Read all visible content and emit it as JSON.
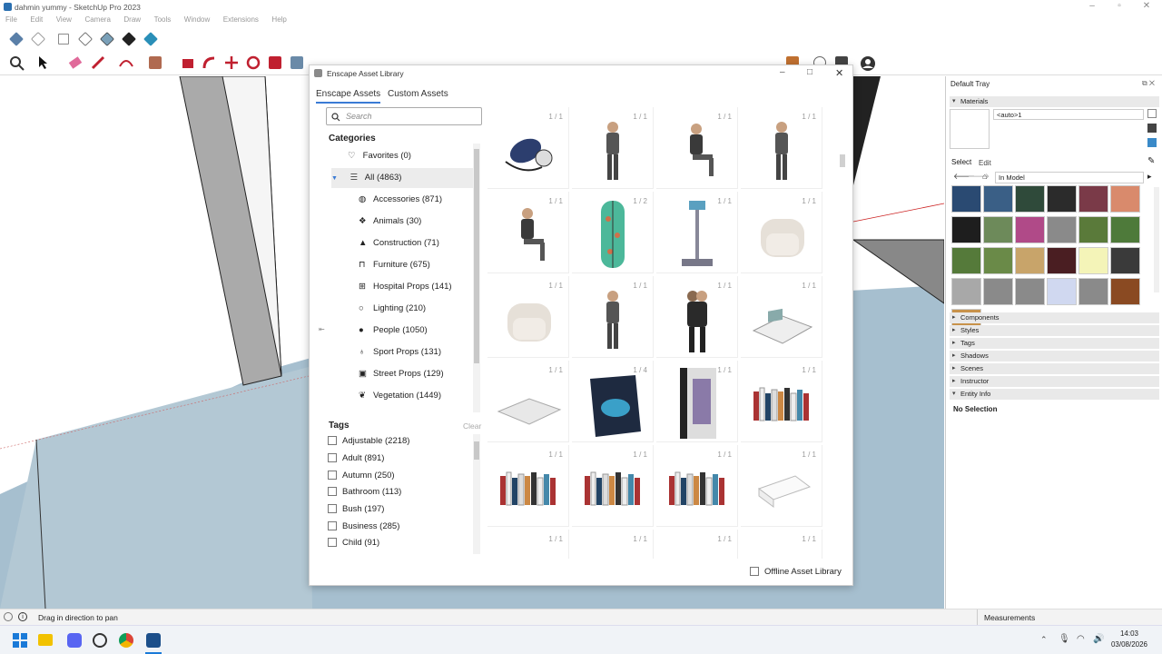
{
  "app": {
    "title": "dahmin yummy - SketchUp Pro 2023"
  },
  "menubar": [
    "File",
    "Edit",
    "View",
    "Camera",
    "Draw",
    "Tools",
    "Window",
    "Extensions",
    "Help"
  ],
  "dialog": {
    "title": "Enscape Asset Library",
    "tabs": [
      "Enscape Assets",
      "Custom Assets"
    ],
    "search_placeholder": "Search",
    "categories_heading": "Categories",
    "categories": [
      {
        "label": "Favorites (0)",
        "icon": "heart-icon"
      },
      {
        "label": "All (4863)",
        "icon": "list-icon"
      },
      {
        "label": "Accessories (871)",
        "icon": "accessories-icon"
      },
      {
        "label": "Animals (30)",
        "icon": "paw-icon"
      },
      {
        "label": "Construction (71)",
        "icon": "hardhat-icon"
      },
      {
        "label": "Furniture (675)",
        "icon": "armchair-icon"
      },
      {
        "label": "Hospital Props (141)",
        "icon": "hospital-icon"
      },
      {
        "label": "Lighting (210)",
        "icon": "bulb-icon"
      },
      {
        "label": "People (1050)",
        "icon": "people-icon"
      },
      {
        "label": "Sport Props (131)",
        "icon": "whistle-icon"
      },
      {
        "label": "Street Props (129)",
        "icon": "street-icon"
      },
      {
        "label": "Vegetation (1449)",
        "icon": "leaf-icon"
      }
    ],
    "tags_heading": "Tags",
    "tags_clear": "Clear",
    "tags": [
      "Adjustable (2218)",
      "Adult (891)",
      "Autumn (250)",
      "Bathroom (113)",
      "Bush (197)",
      "Business (285)",
      "Child (91)"
    ],
    "assets": [
      {
        "count": "1 / 1",
        "kind": "blood-pressure-cuff"
      },
      {
        "count": "1 / 1",
        "kind": "person-standing"
      },
      {
        "count": "1 / 1",
        "kind": "person-sitting"
      },
      {
        "count": "1 / 1",
        "kind": "person-standing"
      },
      {
        "count": "1 / 1",
        "kind": "person-sitting"
      },
      {
        "count": "1 / 2",
        "kind": "bodyboard"
      },
      {
        "count": "1 / 1",
        "kind": "scale"
      },
      {
        "count": "1 / 1",
        "kind": "armchair"
      },
      {
        "count": "1 / 1",
        "kind": "armchair"
      },
      {
        "count": "1 / 1",
        "kind": "person-standing"
      },
      {
        "count": "1 / 1",
        "kind": "couple-hug"
      },
      {
        "count": "1 / 1",
        "kind": "magazine"
      },
      {
        "count": "1 / 1",
        "kind": "open-book"
      },
      {
        "count": "1 / 4",
        "kind": "book-cover"
      },
      {
        "count": "1 / 1",
        "kind": "color-book"
      },
      {
        "count": "1 / 1",
        "kind": "books-row"
      },
      {
        "count": "1 / 1",
        "kind": "books-row"
      },
      {
        "count": "1 / 1",
        "kind": "books-row"
      },
      {
        "count": "1 / 1",
        "kind": "books-row"
      },
      {
        "count": "1 / 1",
        "kind": "white-box"
      },
      {
        "count": "1 / 1",
        "kind": "partial"
      },
      {
        "count": "1 / 1",
        "kind": "partial"
      },
      {
        "count": "1 / 1",
        "kind": "partial"
      },
      {
        "count": "1 / 1",
        "kind": "partial"
      }
    ],
    "offline_label": "Offline Asset Library"
  },
  "tray": {
    "title": "Default Tray",
    "materials_label": "Materials",
    "material_name": "<auto>1",
    "select_tab": "Select",
    "edit_tab": "Edit",
    "in_model": "In Model",
    "swatches": [
      "#2a4a72",
      "#3a5f86",
      "#2f4a3a",
      "#2b2b2b",
      "#7a3a48",
      "#d98a6c",
      "#1e1e1e",
      "#6d8a5a",
      "#b04a88",
      "#8a8a8a",
      "#5a7a3a",
      "#4e7a3a",
      "#557a3a",
      "#6a8a48",
      "#c8a46a",
      "#4a1e22",
      "#f4f4b8",
      "#3a3a3a",
      "#a8a8a8",
      "#8a8a8a",
      "#8a8a8a",
      "#d0d8f0",
      "#8a8a8a",
      "#8a4a22",
      "#c8924a"
    ],
    "sections": [
      "Components",
      "Styles",
      "Tags",
      "Shadows",
      "Scenes",
      "Instructor",
      "Entity Info"
    ],
    "entity_info": "No Selection"
  },
  "status": {
    "hint": "Drag in direction to pan",
    "measurements": "Measurements"
  },
  "taskbar": {
    "time": "14:03",
    "date": "03/08/2026"
  }
}
